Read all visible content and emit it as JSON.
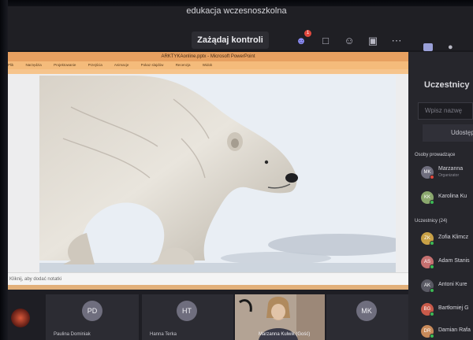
{
  "meeting": {
    "title": "edukacja wczesnoszkolna",
    "request_control_label": "Zażądaj kontroli",
    "participants_badge": "1",
    "icons": [
      "participants-icon",
      "chat-icon",
      "reactions-icon",
      "rooms-icon",
      "more-icon",
      "video-icon",
      "mic-icon"
    ]
  },
  "powerpoint": {
    "window_title": "ARKTYKAonline.pptx - Microsoft PowerPoint",
    "ribbon_tabs": [
      "Plik",
      "Narzędzia",
      "Projektowanie",
      "Przejścia",
      "Animacje",
      "Pokaz slajdów",
      "Recenzja",
      "Widok"
    ],
    "notes_placeholder": "Kliknij, aby dodać notatki",
    "slide_subject": "polar-bear-photo"
  },
  "pane": {
    "title": "Uczestnicy",
    "search_placeholder": "Wpisz nazwę",
    "share_label": "Udostępnij",
    "organizers_heading": "Osoby prowadzące",
    "attendees_heading": "Uczestnicy (24)",
    "organizers": [
      {
        "initials": "MK",
        "name": "Marzanna",
        "role": "Organizator",
        "color": "#6f6e7e",
        "status": "#e0483e"
      },
      {
        "initials": "KK",
        "name": "Karolina Ku",
        "role": "",
        "color": "#8ba86e",
        "status": "#3cba54"
      }
    ],
    "attendees": [
      {
        "initials": "ZK",
        "name": "Zofia Klimcz",
        "color": "#c8a046",
        "status": "#3cba54"
      },
      {
        "initials": "AS",
        "name": "Adam Stanis",
        "color": "#c57070",
        "status": "#3cba54"
      },
      {
        "initials": "AK",
        "name": "Antoni Kure",
        "color": "#5a5a64",
        "status": "#3cba54"
      },
      {
        "initials": "BG",
        "name": "Bartłomiej G",
        "color": "#c85a4a",
        "status": "#3cba54"
      },
      {
        "initials": "DR",
        "name": "Damian Rafa",
        "color": "#c88a5a",
        "status": "#3cba54"
      }
    ]
  },
  "strip": {
    "tiles": [
      {
        "initials": "PD",
        "name": "Paulina Dominiak"
      },
      {
        "initials": "HT",
        "name": "Hanna Terka"
      },
      {
        "initials": "",
        "name": "Marzanna Kulwik (Gość)"
      },
      {
        "initials": "MK",
        "name": ""
      }
    ]
  }
}
